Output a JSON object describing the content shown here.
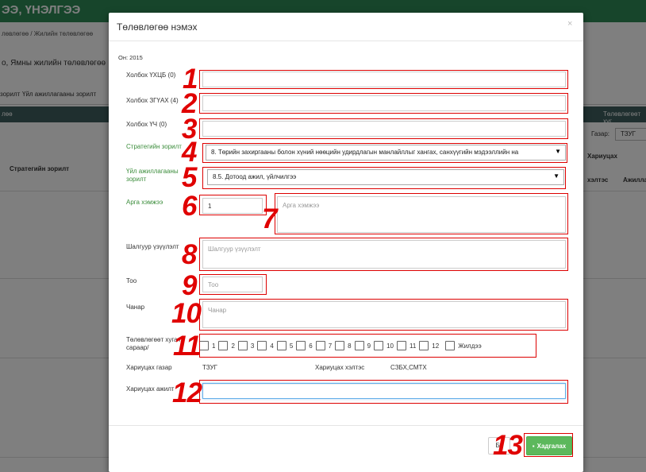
{
  "app": {
    "header": "ЭЭ, ҮНЭЛГЭЭ"
  },
  "background": {
    "breadcrumb": "лөвлөгөө / Жилийн төлөвлөгөө",
    "page_title": "о, Ямны жилийн төлөвлөгөө",
    "tabs": [
      "зорилт",
      "Үйл ажиллагааны зорилт"
    ],
    "band_left": "лөө",
    "band_right": "Төлөвлөгөөт хуг",
    "filter_label": "Газар:",
    "filter_value": "ТЗУГ",
    "col_strategic_goal": "Стратегийн зорилт",
    "col_responsible": "Хариуцах",
    "col_unit": "хэлтэс",
    "col_activity": "Ажилла",
    "col_executor": "Хэрэг"
  },
  "modal": {
    "title": "Төлөвлөгөө нэмэх",
    "close": "×",
    "year_label": "Он: 2015",
    "fields": {
      "link_uhcb_label": "Холбох ҮХЦБ (0)",
      "link_zguah_label": "Холбох ЗГҮАХ (4)",
      "link_uch_label": "Холбох ҮЧ (0)",
      "strategic_goal_label": "Стратегийн зорилт",
      "strategic_goal_value": "8. Төрийн захиргааны болон хүний нөөцийн удирдлагын манлайллыг хангах, санхүүгийн мэдээллийн на",
      "activity_goal_label": "Үйл ажиллагааны зорилт",
      "activity_goal_value": "8.5. Дотоод ажил, үйлчилгээ",
      "method_label": "Арга хэмжээ",
      "method_no_value": "1",
      "method_placeholder": "Арга хэмжээ",
      "criteria_label": "Шалгуур үзүүлэлт",
      "criteria_placeholder": "Шалгуур үзүүлэлт",
      "quantity_label": "Тоо",
      "quantity_placeholder": "Тоо",
      "quality_label": "Чанар",
      "quality_placeholder": "Чанар",
      "schedule_label": "Төлөвлөгөөт хуга /сараар/",
      "months": [
        "1",
        "2",
        "3",
        "4",
        "5",
        "6",
        "7",
        "8",
        "9",
        "10",
        "11",
        "12"
      ],
      "all_year_label": "Жилдээ",
      "responsible_dept_label": "Хариуцах газар",
      "responsible_dept_value": "ТЗУГ",
      "responsible_unit_label": "Хариуцах хэлтэс",
      "responsible_unit_value": "СЗБХ,СМТХ",
      "responsible_staff_label": "Хариуцах ажилт"
    },
    "buttons": {
      "back": "Бу",
      "save": "Хадгалах"
    },
    "annotations": [
      "1",
      "2",
      "3",
      "4",
      "5",
      "6",
      "7",
      "8",
      "9",
      "10",
      "11",
      "12",
      "13"
    ]
  }
}
